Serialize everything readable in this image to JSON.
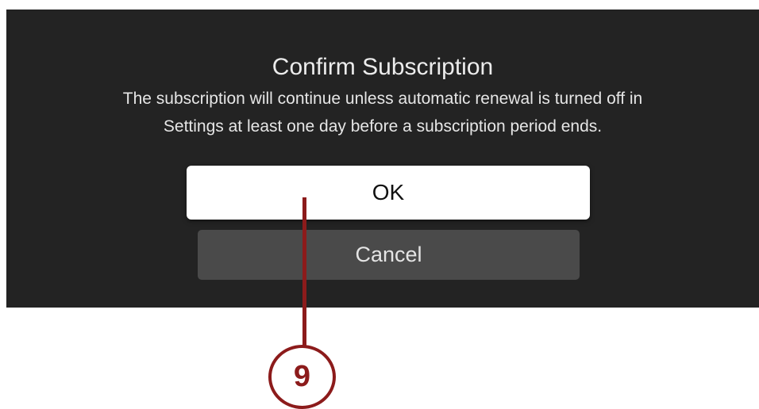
{
  "dialog": {
    "title": "Confirm Subscription",
    "message_line1": "The subscription will continue unless automatic renewal is turned off in",
    "message_line2": "Settings at least one day before a subscription period ends.",
    "ok_label": "OK",
    "cancel_label": "Cancel"
  },
  "callout": {
    "number": "9",
    "color": "#8c1b1b"
  },
  "colors": {
    "dialog_background": "#232323",
    "ok_button": "#ffffff",
    "cancel_button": "#4a4a4a"
  }
}
